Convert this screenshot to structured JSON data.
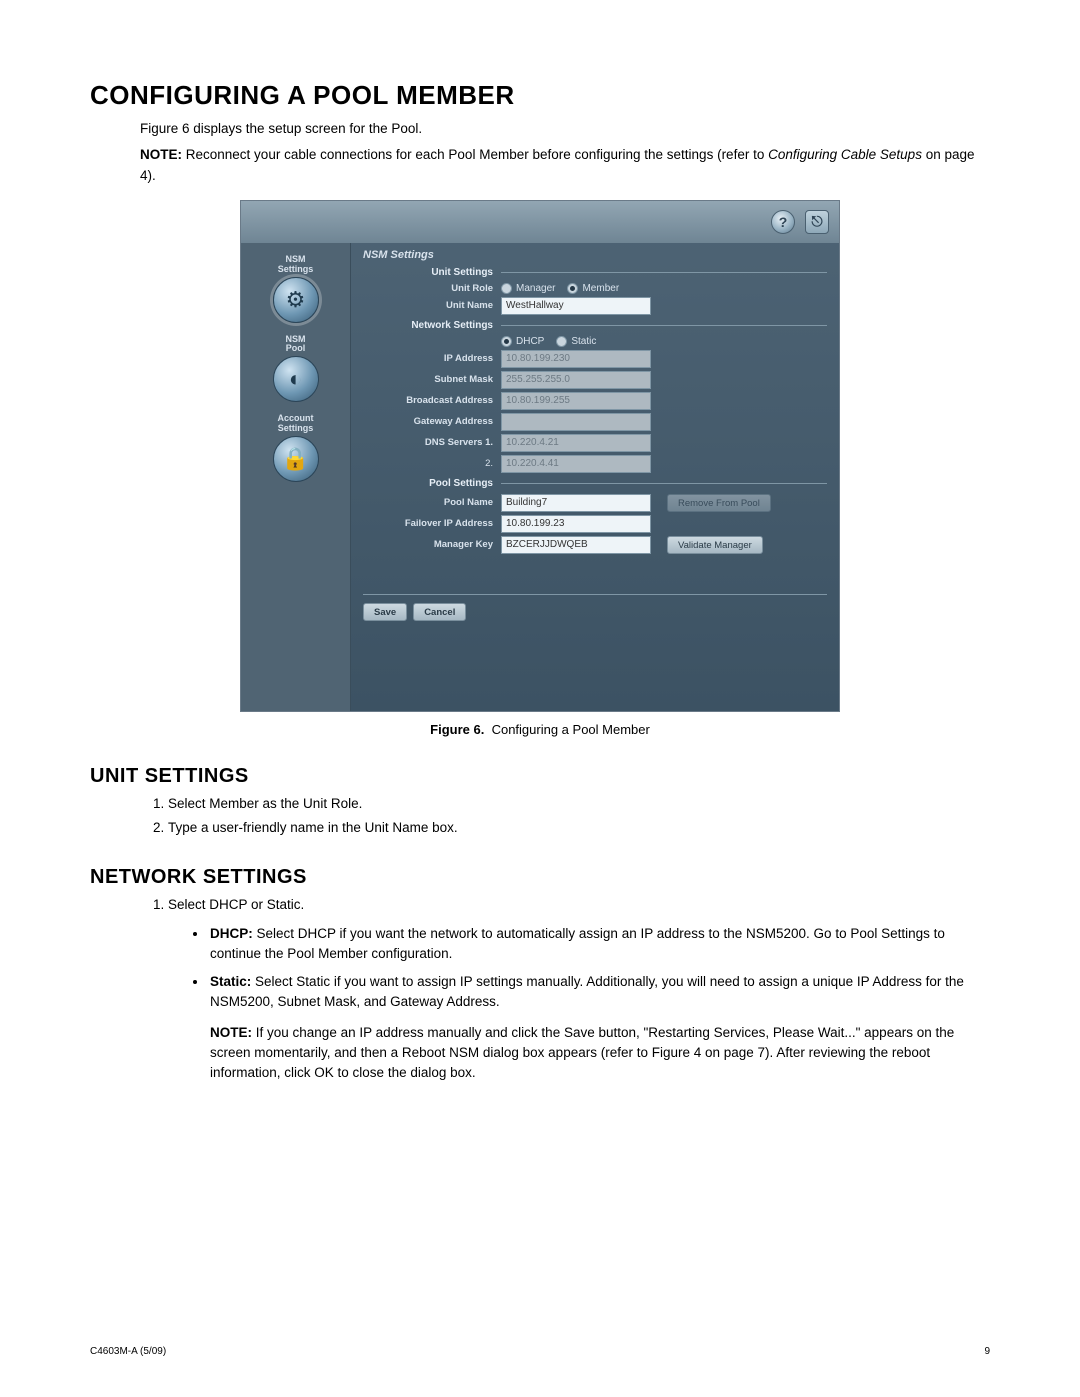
{
  "page": {
    "h1": "CONFIGURING A POOL MEMBER",
    "intro": "Figure 6 displays the setup screen for the Pool.",
    "note_label": "NOTE:",
    "note_text": "Reconnect your cable connections for each Pool Member before configuring the settings (refer to ",
    "note_em": "Configuring Cable Setups",
    "note_tail": " on page 4).",
    "fig_label": "Figure 6.",
    "fig_caption": "Configuring a Pool Member",
    "h2_unit": "UNIT SETTINGS",
    "unit_steps": [
      "Select Member as the Unit Role.",
      "Type a user-friendly name in the Unit Name box."
    ],
    "h2_net": "NETWORK SETTINGS",
    "net_step1": "Select DHCP or Static.",
    "net_bullets": [
      {
        "b": "DHCP:",
        "t": " Select DHCP if you want the network to automatically assign an IP address to the NSM5200. Go to Pool Settings to continue the Pool Member configuration."
      },
      {
        "b": "Static:",
        "t": " Select Static if you want to assign IP settings manually. Additionally, you will need to assign a unique IP Address for the NSM5200, Subnet Mask, and Gateway Address."
      }
    ],
    "net_note_label": "NOTE:",
    "net_note_text": " If you change an IP address manually and click the Save button, \"Restarting Services, Please Wait...\" appears on the screen momentarily, and then a Reboot NSM dialog box appears (refer to Figure 4 on page 7). After reviewing the reboot information, click OK to close the dialog box.",
    "footer_left": "C4603M-A (5/09)",
    "footer_right": "9"
  },
  "shot": {
    "pane_title": "NSM Settings",
    "help_icon": "?",
    "logout_icon": "⎋",
    "sidebar": [
      {
        "l1": "NSM",
        "l2": "Settings",
        "icon": "⚙"
      },
      {
        "l1": "NSM",
        "l2": "Pool",
        "icon": "◐"
      },
      {
        "l1": "Account",
        "l2": "Settings",
        "icon": "🔒"
      }
    ],
    "unit": {
      "heading": "Unit Settings",
      "role_label": "Unit Role",
      "role_opts": [
        "Manager",
        "Member"
      ],
      "role_selected": 1,
      "name_label": "Unit Name",
      "name_value": "WestHallway"
    },
    "net": {
      "heading": "Network Settings",
      "mode_opts": [
        "DHCP",
        "Static"
      ],
      "mode_selected": 0,
      "ip_label": "IP Address",
      "ip_value": "10.80.199.230",
      "subnet_label": "Subnet Mask",
      "subnet_value": "255.255.255.0",
      "bcast_label": "Broadcast Address",
      "bcast_value": "10.80.199.255",
      "gw_label": "Gateway Address",
      "gw_value": "",
      "dns_label": "DNS Servers   1.",
      "dns1_value": "10.220.4.21",
      "dns2_label": "2.",
      "dns2_value": "10.220.4.41"
    },
    "pool": {
      "heading": "Pool Settings",
      "name_label": "Pool Name",
      "name_value": "Building7",
      "remove_btn": "Remove From Pool",
      "failover_label": "Failover IP Address",
      "failover_value": "10.80.199.23",
      "mgrkey_label": "Manager Key",
      "mgrkey_value": "BZCERJJDWQEB",
      "validate_btn": "Validate Manager"
    },
    "actions": {
      "save": "Save",
      "cancel": "Cancel"
    }
  }
}
